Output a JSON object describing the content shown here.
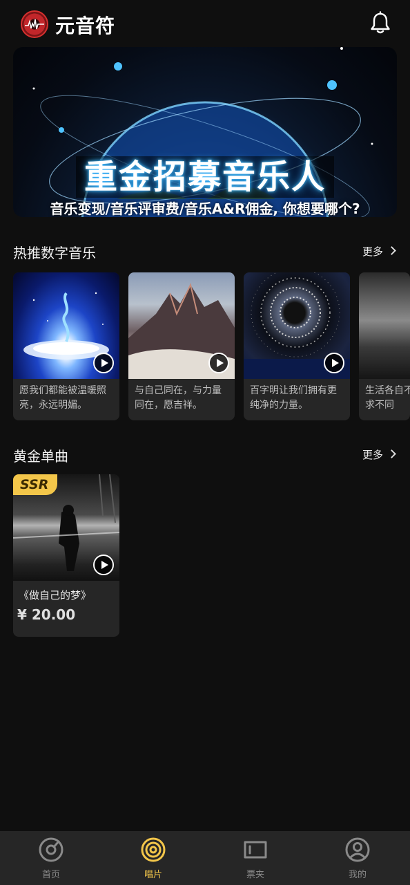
{
  "header": {
    "app_name": "元音符",
    "logo_icon": "vinyl-logo-icon",
    "bell_icon": "bell-icon"
  },
  "banner": {
    "title": "重金招募音乐人",
    "subtitle": "音乐变现/音乐评审费/音乐A&R佣金, 你想要哪个?"
  },
  "hot_section": {
    "title": "热推数字音乐",
    "more_label": "更多",
    "items": [
      {
        "caption": "愿我们都能被温暖照亮，永远明媚。"
      },
      {
        "caption": "与自己同在，与力量同在，愿吉祥。"
      },
      {
        "caption": "百字明让我们拥有更纯净的力量。"
      },
      {
        "caption": "生活各自不同，人所求不同"
      }
    ]
  },
  "gold_section": {
    "title": "黄金单曲",
    "more_label": "更多",
    "items": [
      {
        "badge": "SSR",
        "title": "《做自己的梦》",
        "price": "¥ 20.00"
      }
    ]
  },
  "bottom_nav": {
    "items": [
      {
        "label": "首页",
        "icon": "home-disc-icon"
      },
      {
        "label": "唱片",
        "icon": "record-icon",
        "active": true
      },
      {
        "label": "票夹",
        "icon": "ticket-icon"
      },
      {
        "label": "我的",
        "icon": "profile-icon"
      }
    ]
  },
  "colors": {
    "accent": "#f3c64a",
    "background": "#0f0f0f",
    "card": "#262626",
    "logo_red": "#c2262a"
  }
}
